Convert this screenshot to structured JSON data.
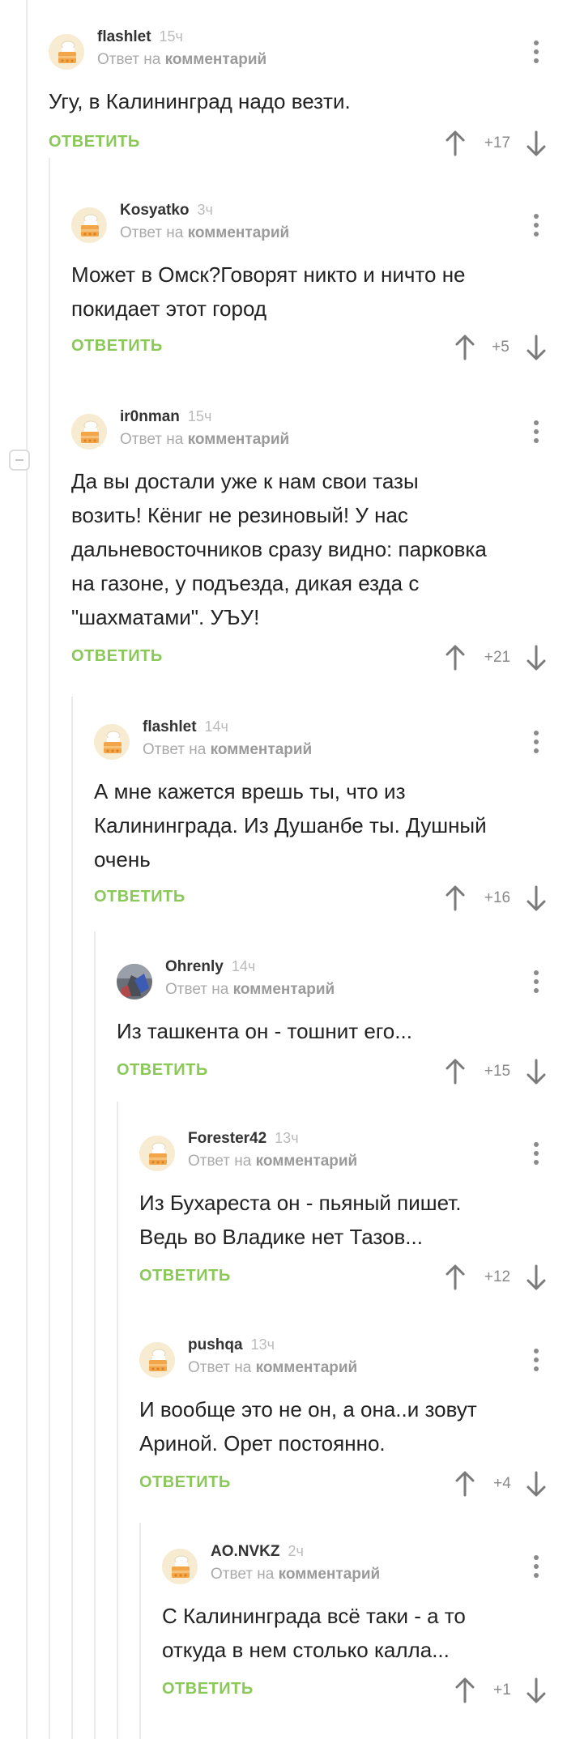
{
  "ui": {
    "reply_prefix": "Ответ на",
    "reply_target": "комментарий",
    "reply_button": "ОТВЕТИТЬ"
  },
  "comments": [
    {
      "username": "flashlet",
      "time": "15ч",
      "text": "Угу, в Калининград надо везти.",
      "rating": "+17",
      "avatar": "cake"
    },
    {
      "username": "Kosyatko",
      "time": "3ч",
      "text": "Может в Омск?Говорят никто и ничто не\nпокидает этот город",
      "rating": "+5",
      "avatar": "cake"
    },
    {
      "username": "ir0nman",
      "time": "15ч",
      "text": "Да вы достали уже к нам свои тазы\nвозить! Кёниг не резиновый! У нас\nдальневосточников сразу видно: парковка\nна газоне, у подъезда, дикая езда с\n\"шахматами\". УЪУ!",
      "rating": "+21",
      "avatar": "cake"
    },
    {
      "username": "flashlet",
      "time": "14ч",
      "text": "А мне кажется врешь ты, что из\nКалининграда. Из Душанбе ты. Душный\nочень",
      "rating": "+16",
      "avatar": "cake"
    },
    {
      "username": "Ohrenly",
      "time": "14ч",
      "text": "Из ташкента он - тошнит его...",
      "rating": "+15",
      "avatar": "photo"
    },
    {
      "username": "Forester42",
      "time": "13ч",
      "text": "Из Бухареста он - пьяный пишет.\nВедь во Владике нет Тазов...",
      "rating": "+12",
      "avatar": "cake"
    },
    {
      "username": "pushqa",
      "time": "13ч",
      "text": "И вообще это не он, а она..и зовут\nАриной. Орет постоянно.",
      "rating": "+4",
      "avatar": "cake"
    },
    {
      "username": "AO.NVKZ",
      "time": "2ч",
      "text": "С Калининграда всё таки - а то\nоткуда в нем столько калла...",
      "rating": "+1",
      "avatar": "cake"
    }
  ],
  "colors": {
    "reply_button": "#8ac858",
    "thread_line": "#ebebeb",
    "muted_text": "#aaaaaa"
  }
}
